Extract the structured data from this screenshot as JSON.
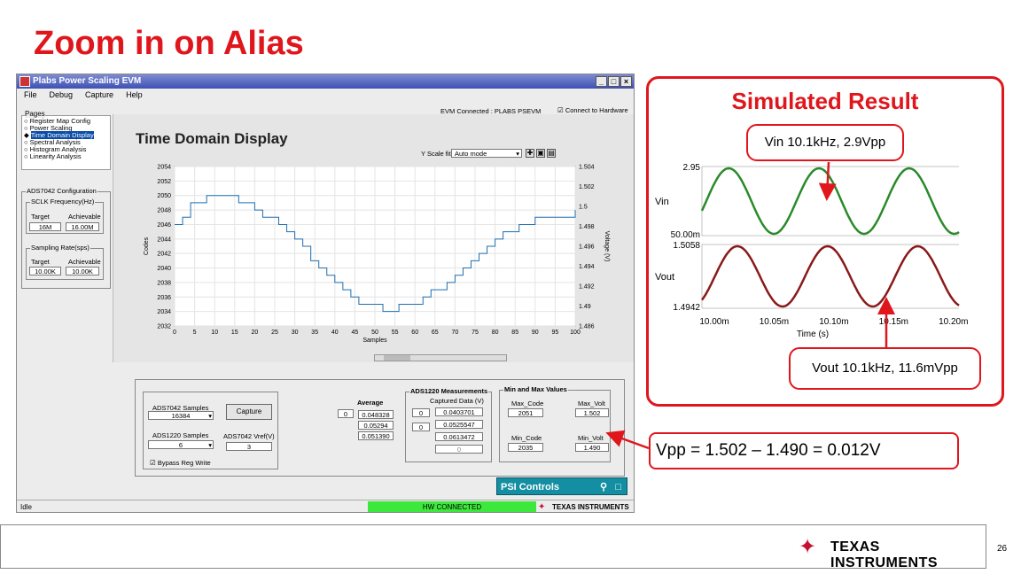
{
  "slide": {
    "title": "Zoom in on Alias",
    "page_number": "26",
    "footer_brand": "Texas Instruments"
  },
  "app": {
    "window_title": "Plabs Power Scaling EVM",
    "menu": [
      "File",
      "Debug",
      "Capture",
      "Help"
    ],
    "evm_status": "EVM Connected : PLABS PSEVM",
    "connect_label": "Connect to Hardware",
    "pages_label": "Pages",
    "pages": [
      "Register Map Config",
      "Power Scaling",
      "Time Domain Display",
      "Spectral Analysis",
      "Histogram Analysis",
      "Linearity Analysis"
    ],
    "selected_page": "Time Domain Display",
    "ads_config": {
      "title": "ADS7042 Configuration",
      "sclk_label": "SCLK Frequency(Hz)",
      "target_label": "Target",
      "achievable_label": "Achievable",
      "sclk_target": "16M",
      "sclk_achievable": "16.00M",
      "rate_label": "Sampling Rate(sps)",
      "rate_target": "10.00K",
      "rate_achievable": "10.00K"
    },
    "display_title": "Time Domain Display",
    "yscale_label": "Y Scale fit",
    "yscale_value": "Auto mode",
    "status_left": "Idle",
    "status_conn": "HW CONNECTED",
    "status_brand": "Texas Instruments",
    "psi_label": "PSI Controls",
    "capture": {
      "ads7042_samples_label": "ADS7042 Samples",
      "ads7042_samples": "16384",
      "ads1220_samples_label": "ADS1220 Samples",
      "ads1220_samples": "6",
      "vref_label": "ADS7042 Vref(V)",
      "vref": "3",
      "capture_btn": "Capture",
      "bypass_label": "Bypass Reg Write",
      "average_label": "Average",
      "average_index": "0",
      "average_values": [
        "0.048328",
        "0.05294",
        "0.051390"
      ],
      "ads1220_title": "ADS1220 Measurements",
      "captured_label": "Captured Data (V)",
      "meas_index": [
        "0",
        "0"
      ],
      "meas_values": [
        "0.0403701",
        "0.0525547",
        "0.0613472",
        "0"
      ],
      "minmax_title": "Min and Max Values",
      "max_code_label": "Max_Code",
      "max_code": "2051",
      "max_volt_label": "Max_Volt",
      "max_volt": "1.502",
      "min_code_label": "Min_Code",
      "min_code": "2035",
      "min_volt_label": "Min_Volt",
      "min_volt": "1.490"
    }
  },
  "chart_data": [
    {
      "type": "line",
      "title": "",
      "xlabel": "Samples",
      "ylabel": "Codes",
      "ylabel_right": "Voltage (V)",
      "xlim": [
        0,
        100
      ],
      "ylim": [
        2032,
        2054
      ],
      "x_ticks": [
        0,
        5,
        10,
        15,
        20,
        25,
        30,
        35,
        40,
        45,
        50,
        55,
        60,
        65,
        70,
        75,
        80,
        85,
        90,
        95,
        100
      ],
      "y_ticks": [
        2032,
        2034,
        2036,
        2038,
        2040,
        2042,
        2044,
        2046,
        2048,
        2050,
        2052,
        2054
      ],
      "y_right_ticks": [
        "1.486",
        "1.49",
        "1.492",
        "1.494",
        "1.496",
        "1.498",
        "1.5",
        "1.502",
        "1.504"
      ],
      "series": [
        {
          "color": "#1f6fb0",
          "x": [
            0,
            2,
            4,
            6,
            8,
            10,
            12,
            14,
            16,
            18,
            20,
            22,
            24,
            26,
            28,
            30,
            32,
            34,
            36,
            38,
            40,
            42,
            44,
            46,
            48,
            50,
            52,
            54,
            56,
            58,
            60,
            62,
            64,
            66,
            68,
            70,
            72,
            74,
            76,
            78,
            80,
            82,
            84,
            86,
            88,
            90,
            92,
            94,
            96,
            98,
            100
          ],
          "y": [
            2046,
            2047,
            2049,
            2049,
            2050,
            2050,
            2050,
            2050,
            2049,
            2049,
            2048,
            2047,
            2047,
            2046,
            2045,
            2044,
            2043,
            2041,
            2040,
            2039,
            2038,
            2037,
            2036,
            2035,
            2035,
            2035,
            2034,
            2034,
            2035,
            2035,
            2035,
            2036,
            2037,
            2037,
            2038,
            2039,
            2040,
            2041,
            2042,
            2043,
            2044,
            2045,
            2045,
            2046,
            2046,
            2047,
            2047,
            2047,
            2047,
            2047,
            2048
          ]
        }
      ]
    },
    {
      "type": "line",
      "title": "Simulated Result",
      "xlabel": "Time (s)",
      "x_ticks": [
        "10.00m",
        "10.05m",
        "10.10m",
        "10.15m",
        "10.20m"
      ],
      "panels": [
        {
          "name": "Vin",
          "color": "#2a8a2a",
          "top_label": "2.95",
          "bottom_label": "50.00m",
          "cycles": 3
        },
        {
          "name": "Vout",
          "color": "#8a1a1a",
          "top_label": "1.5058",
          "bottom_label": "1.4942",
          "cycles": 3
        }
      ]
    }
  ],
  "callouts": {
    "vin": "Vin 10.1kHz, 2.9Vpp",
    "vout": "Vout 10.1kHz, 11.6mVpp",
    "vpp": "Vpp = 1.502 – 1.490 = 0.012V"
  }
}
